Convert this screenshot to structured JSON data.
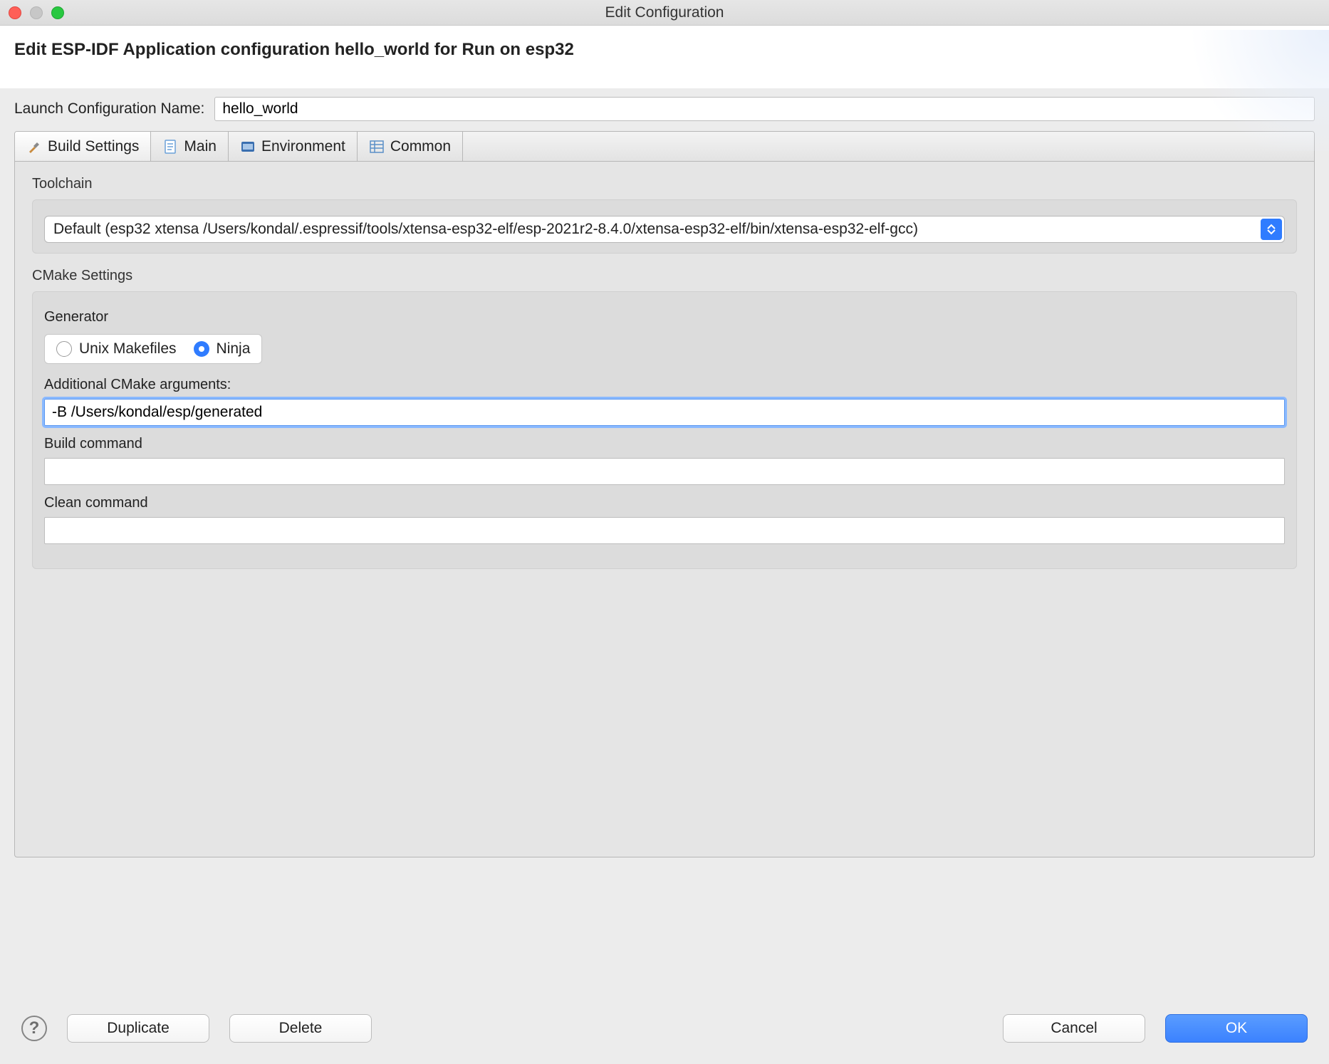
{
  "window": {
    "title": "Edit Configuration"
  },
  "header": {
    "title": "Edit ESP-IDF Application configuration hello_world for Run on esp32"
  },
  "nameRow": {
    "label": "Launch Configuration Name:",
    "value": "hello_world"
  },
  "tabs": {
    "build": "Build Settings",
    "main": "Main",
    "environment": "Environment",
    "common": "Common"
  },
  "toolchain": {
    "label": "Toolchain",
    "value": "Default (esp32 xtensa /Users/kondal/.espressif/tools/xtensa-esp32-elf/esp-2021r2-8.4.0/xtensa-esp32-elf/bin/xtensa-esp32-elf-gcc)"
  },
  "cmake": {
    "section_label": "CMake Settings",
    "generator_label": "Generator",
    "options": {
      "unix": "Unix Makefiles",
      "ninja": "Ninja"
    },
    "selected": "ninja",
    "additional_args_label": "Additional CMake arguments:",
    "additional_args_value": "-B /Users/kondal/esp/generated",
    "build_command_label": "Build command",
    "build_command_value": "",
    "clean_command_label": "Clean command",
    "clean_command_value": ""
  },
  "buttons": {
    "help": "?",
    "duplicate": "Duplicate",
    "delete": "Delete",
    "cancel": "Cancel",
    "ok": "OK"
  }
}
